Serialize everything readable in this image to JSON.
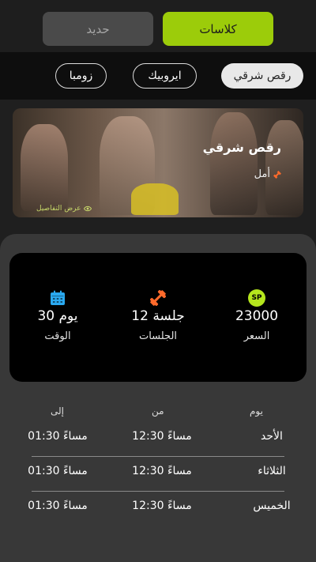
{
  "toggle": {
    "classes_label": "كلاسات",
    "iron_label": "حديد"
  },
  "categories": [
    {
      "label": "رقص شرقي",
      "selected": true
    },
    {
      "label": "ايروبيك",
      "selected": false
    },
    {
      "label": "زومبا",
      "selected": false
    }
  ],
  "class_card": {
    "title": "رقص شرقي",
    "trainer": "أمل",
    "details_label": "عرض التفاصيل"
  },
  "stats": {
    "price": {
      "badge": "SP",
      "value": "23000",
      "label": "السعر"
    },
    "sessions": {
      "value": "12 جلسة",
      "label": "الجلسات",
      "icon": "dumbbell-icon"
    },
    "duration": {
      "value": "30 يوم",
      "label": "الوقت",
      "icon": "calendar-icon"
    }
  },
  "schedule": {
    "headers": {
      "day": "يوم",
      "from": "من",
      "to": "إلى"
    },
    "rows": [
      {
        "day": "الأحد",
        "from": "12:30 مساءً",
        "to": "01:30 مساءً"
      },
      {
        "day": "الثلاثاء",
        "from": "12:30 مساءً",
        "to": "01:30 مساءً"
      },
      {
        "day": "الخميس",
        "from": "12:30 مساءً",
        "to": "01:30 مساءً"
      }
    ]
  },
  "colors": {
    "accent": "#9ccc0a",
    "sp_badge": "#b5e61d",
    "dumbbell": "#ff6a2b",
    "calendar": "#2aa9f0"
  }
}
